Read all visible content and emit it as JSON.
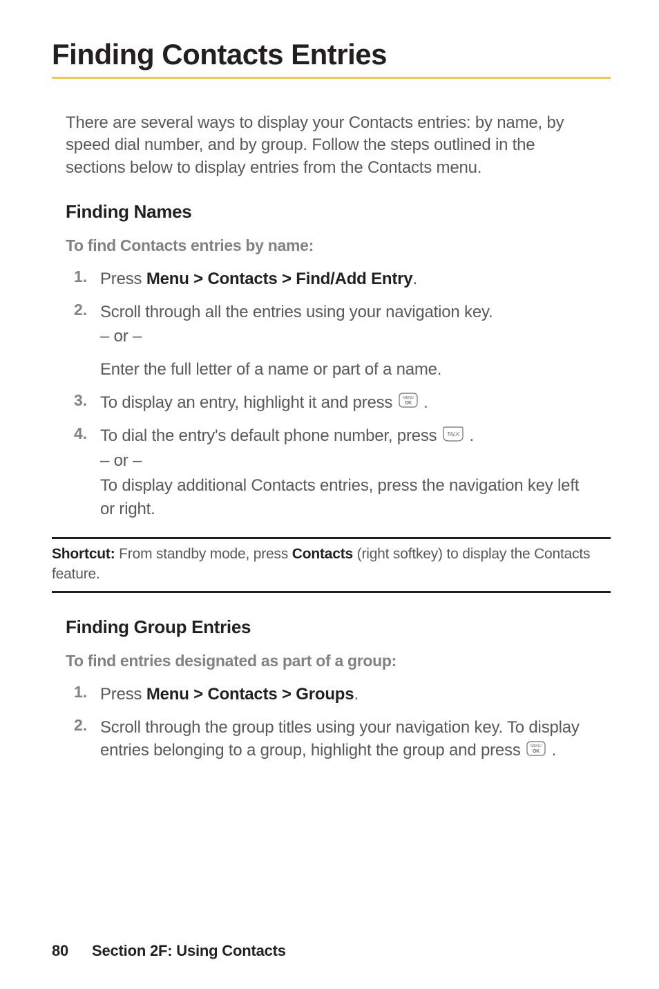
{
  "title": "Finding Contacts Entries",
  "intro": "There are several ways to display your Contacts entries: by name, by speed dial number, and by group. Follow the steps outlined in the sections below to display entries from the Contacts menu.",
  "section1": {
    "heading": "Finding Names",
    "instruction": "To find Contacts entries by name:",
    "steps": {
      "s1": {
        "num": "1.",
        "pre": "Press ",
        "bold": "Menu > Contacts > Find/Add Entry",
        "post": "."
      },
      "s2": {
        "num": "2.",
        "text": "Scroll through all the entries using your navigation key.",
        "or": "– or –",
        "sub": "Enter the full letter of a name or part of a name."
      },
      "s3": {
        "num": "3.",
        "text": "To display an entry, highlight it and press ",
        "post": "."
      },
      "s4": {
        "num": "4.",
        "text": "To dial the entry's default phone number, press ",
        "post": " .",
        "or": "– or –",
        "sub": "To display additional Contacts entries, press the navigation key left or right."
      }
    }
  },
  "shortcut": {
    "label": "Shortcut:",
    "pre": " From standby mode, press ",
    "bold": "Contacts",
    "post": " (right softkey) to display the Contacts feature."
  },
  "section2": {
    "heading": "Finding Group Entries",
    "instruction": "To find entries designated as part of a group:",
    "steps": {
      "s1": {
        "num": "1.",
        "pre": "Press ",
        "bold": "Menu > Contacts > Groups",
        "post": "."
      },
      "s2": {
        "num": "2.",
        "text": "Scroll through the group titles using your navigation key. To display entries belonging to a group, highlight the group and press ",
        "post": "."
      }
    }
  },
  "footer": {
    "page": "80",
    "section": "Section 2F: Using Contacts"
  },
  "icons": {
    "menu_ok": "MENU OK",
    "talk": "TALK"
  }
}
